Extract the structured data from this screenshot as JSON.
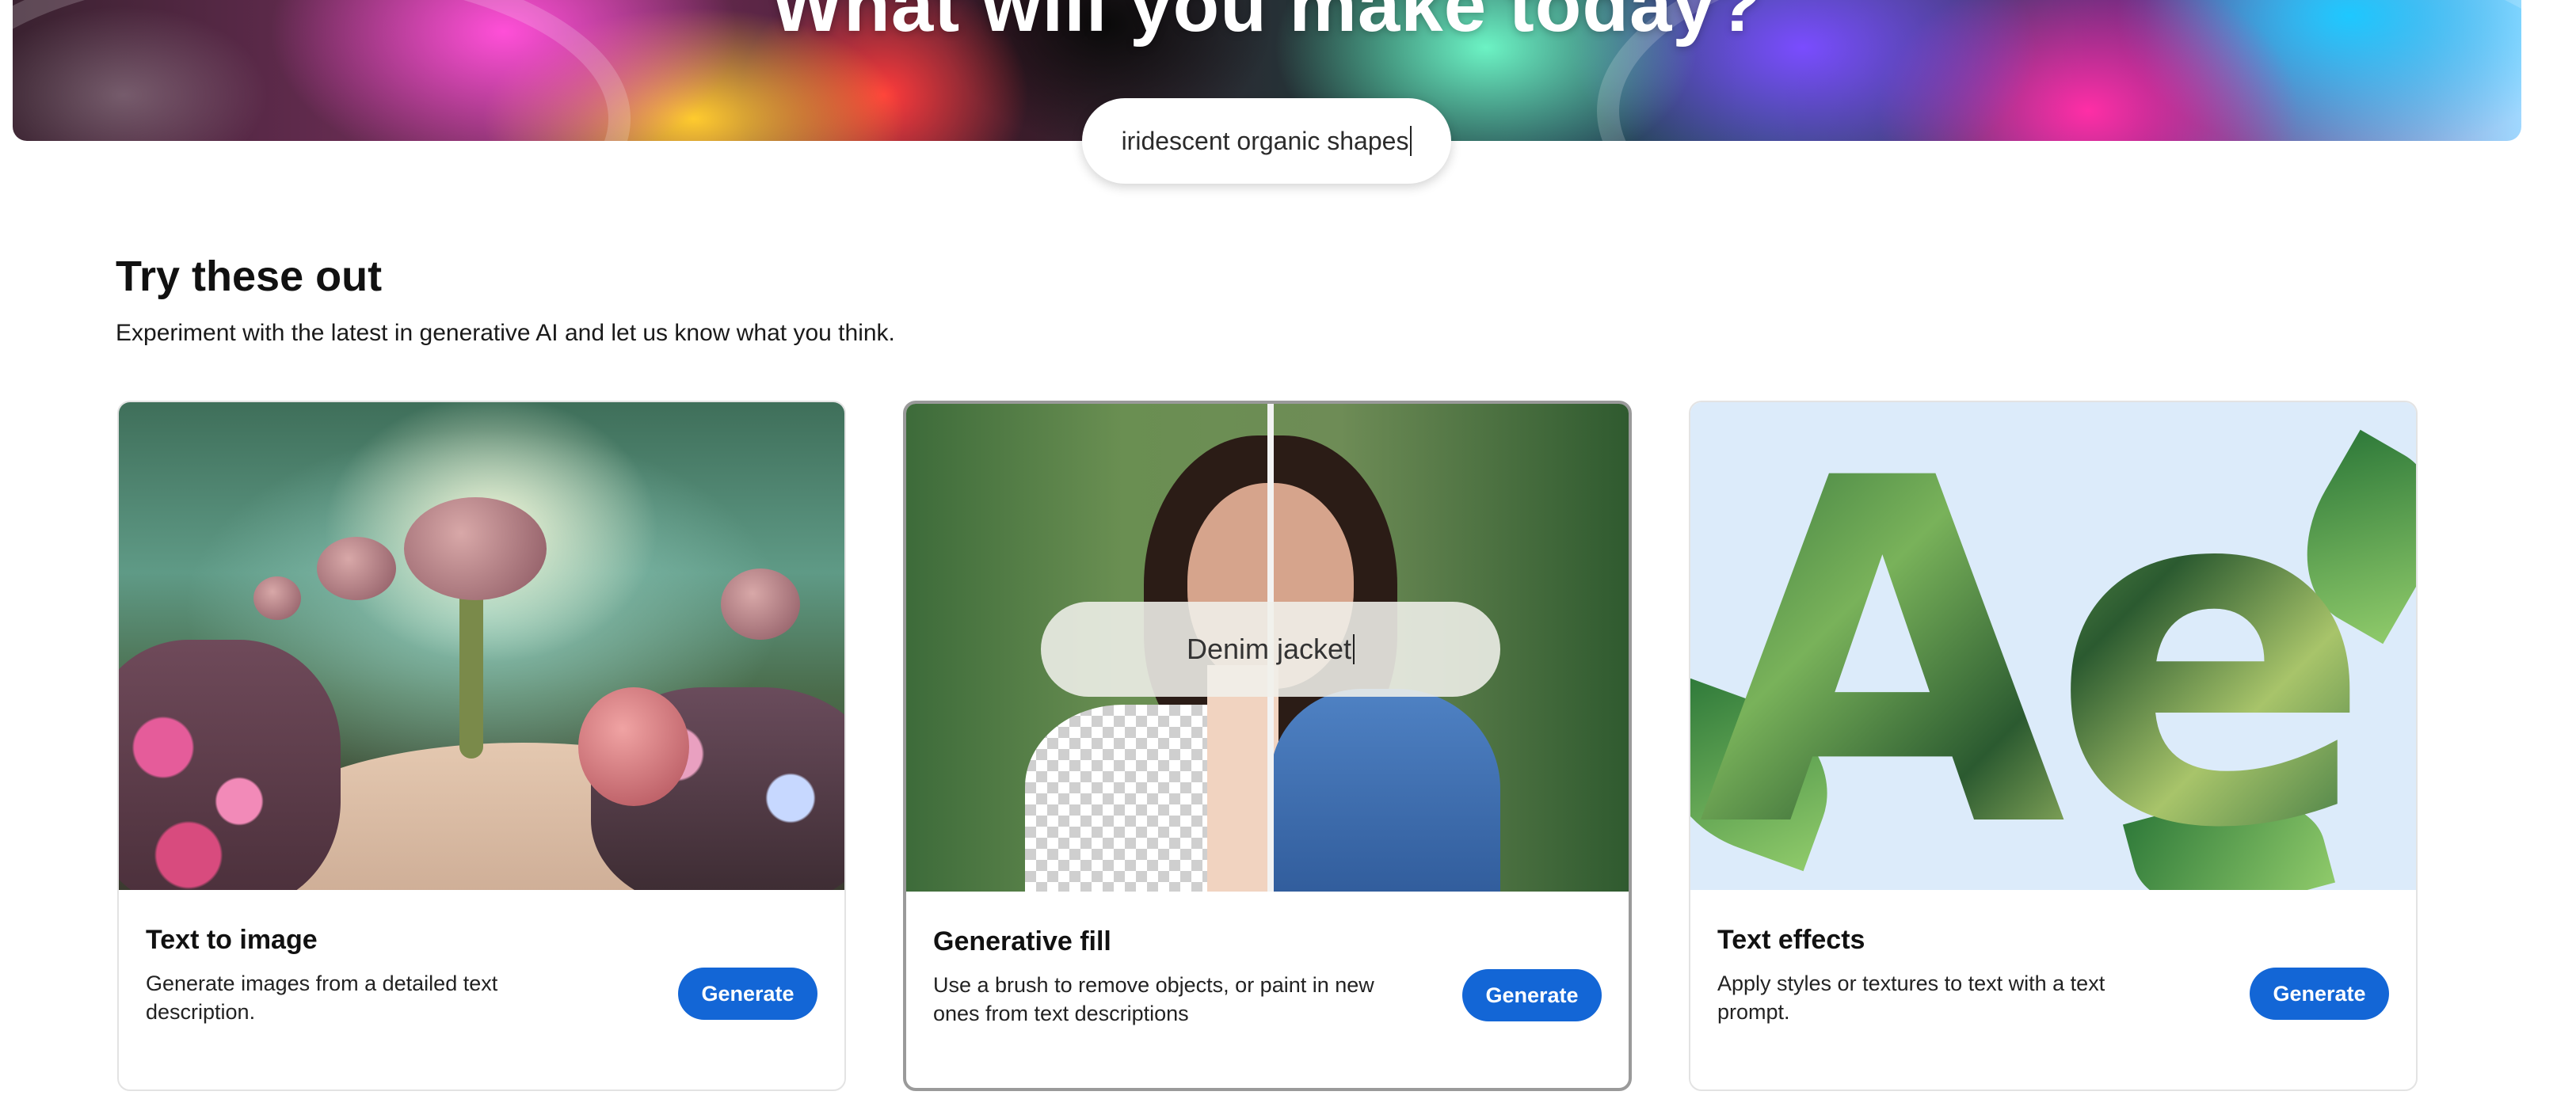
{
  "hero": {
    "title": "What will you make today?"
  },
  "prompt": {
    "value": "iridescent organic shapes"
  },
  "section": {
    "title": "Try these out",
    "subtitle": "Experiment with the latest in generative AI and let us know what you think."
  },
  "cards": [
    {
      "title": "Text to image",
      "description": "Generate images from a detailed text description.",
      "button": "Generate"
    },
    {
      "title": "Generative fill",
      "description": "Use a brush to remove objects, or paint in new ones from text descriptions",
      "button": "Generate",
      "overlay_prompt": "Denim jacket"
    },
    {
      "title": "Text effects",
      "description": "Apply styles or textures to text with a text prompt.",
      "button": "Generate",
      "effect_text": "Ae"
    }
  ],
  "colors": {
    "button_bg": "#1366d6",
    "button_text": "#ffffff",
    "selected_border": "#9a9a9a"
  }
}
